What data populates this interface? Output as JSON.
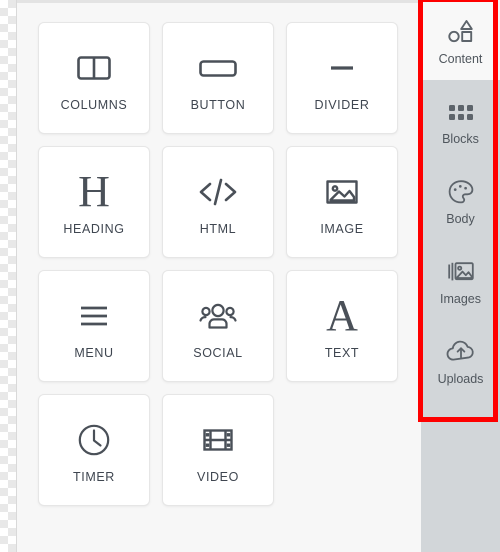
{
  "editor": {
    "panel_title": "Content",
    "tiles": [
      {
        "label": "COLUMNS",
        "icon": "columns-icon"
      },
      {
        "label": "BUTTON",
        "icon": "button-icon"
      },
      {
        "label": "DIVIDER",
        "icon": "divider-icon"
      },
      {
        "label": "HEADING",
        "icon": "heading-icon"
      },
      {
        "label": "HTML",
        "icon": "code-icon"
      },
      {
        "label": "IMAGE",
        "icon": "image-icon"
      },
      {
        "label": "MENU",
        "icon": "menu-icon"
      },
      {
        "label": "SOCIAL",
        "icon": "social-icon"
      },
      {
        "label": "TEXT",
        "icon": "text-icon"
      },
      {
        "label": "TIMER",
        "icon": "timer-icon"
      },
      {
        "label": "VIDEO",
        "icon": "video-icon"
      }
    ],
    "heading_glyph": "H",
    "text_glyph": "A"
  },
  "sidebar": {
    "items": [
      {
        "label": "Content",
        "icon": "shapes-icon",
        "active": true
      },
      {
        "label": "Blocks",
        "icon": "grid-icon",
        "active": false
      },
      {
        "label": "Body",
        "icon": "palette-icon",
        "active": false
      },
      {
        "label": "Images",
        "icon": "photos-icon",
        "active": false
      },
      {
        "label": "Uploads",
        "icon": "upload-cloud-icon",
        "active": false
      }
    ]
  },
  "annotation": {
    "highlight_color": "#fe0000"
  },
  "colors": {
    "canvas_bg": "#f7f7f7",
    "tile_bg": "#ffffff",
    "tile_border": "#e6e6e6",
    "sidebar_bg": "#d2d6d9",
    "sidebar_active_bg": "#f8f8f8",
    "icon": "#4a5058",
    "label": "#3f4650"
  }
}
